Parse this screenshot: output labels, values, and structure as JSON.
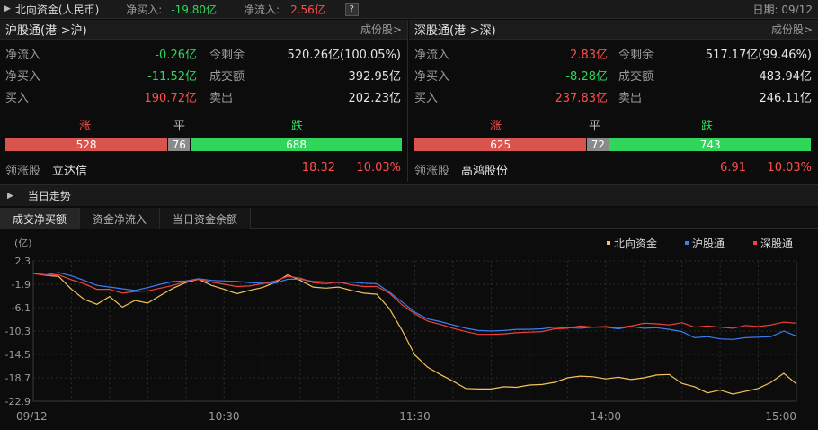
{
  "topbar": {
    "title": "北向资金(人民币)",
    "net_buy_label": "净买入:",
    "net_buy_value": "-19.80亿",
    "net_inflow_label": "净流入:",
    "net_inflow_value": "2.56亿",
    "help": "?",
    "date": "日期: 09/12"
  },
  "sh": {
    "title": "沪股通(港->沪)",
    "link": "成份股>",
    "net_inflow_label": "净流入",
    "net_inflow": "-0.26亿",
    "remain_label": "今剩余",
    "remain": "520.26亿(100.05%)",
    "net_buy_label": "净买入",
    "net_buy": "-11.52亿",
    "turnover_label": "成交额",
    "turnover": "392.95亿",
    "buy_label": "买入",
    "buy": "190.72亿",
    "sell_label": "卖出",
    "sell": "202.23亿",
    "up_label": "涨",
    "flat_label": "平",
    "down_label": "跌",
    "up": 528,
    "flat": 76,
    "down": 688,
    "lead_label": "领涨股",
    "lead_name": "立达信",
    "lead_price": "18.32",
    "lead_pct": "10.03%"
  },
  "sz": {
    "title": "深股通(港->深)",
    "link": "成份股>",
    "net_inflow_label": "净流入",
    "net_inflow": "2.83亿",
    "remain_label": "今剩余",
    "remain": "517.17亿(99.46%)",
    "net_buy_label": "净买入",
    "net_buy": "-8.28亿",
    "turnover_label": "成交额",
    "turnover": "483.94亿",
    "buy_label": "买入",
    "buy": "237.83亿",
    "sell_label": "卖出",
    "sell": "246.11亿",
    "up_label": "涨",
    "flat_label": "平",
    "down_label": "跌",
    "up": 625,
    "flat": 72,
    "down": 743,
    "lead_label": "领涨股",
    "lead_name": "高鸿股份",
    "lead_price": "6.91",
    "lead_pct": "10.03%"
  },
  "trend": {
    "title": "当日走势"
  },
  "tabs": [
    "成交净买额",
    "资金净流入",
    "当日资金余额"
  ],
  "colors": {
    "red": "#ff4d4d",
    "green": "#2fd65a",
    "gray": "#8a8a8a",
    "north": "#f3c35a",
    "sh": "#3b7ff5",
    "sz": "#f0413c"
  },
  "chart_data": {
    "type": "line",
    "unit_label": "(亿)",
    "ylim": [
      -22.9,
      2.3
    ],
    "yticks": [
      "2.3",
      "-1.9",
      "-6.1",
      "-10.3",
      "-14.5",
      "-18.7",
      "-22.9"
    ],
    "xticks": [
      "09/12",
      "10:30",
      "11:30",
      "14:00",
      "15:00"
    ],
    "x": [
      0,
      4,
      8,
      12,
      16,
      20,
      24,
      28,
      32,
      36,
      40,
      44,
      48,
      52,
      56,
      60,
      64,
      68,
      72,
      76,
      80,
      84,
      88,
      92,
      96,
      100,
      104,
      108,
      112,
      116,
      120,
      124,
      128,
      132,
      136,
      140,
      144,
      148,
      152,
      156,
      160,
      164,
      168,
      172,
      176,
      180,
      184,
      188,
      192,
      196,
      200,
      204,
      208,
      212,
      216,
      220,
      224,
      228,
      232,
      236,
      240
    ],
    "series": [
      {
        "name": "北向资金",
        "values": [
          0.1,
          -0.3,
          -0.5,
          -2.8,
          -4.6,
          -5.5,
          -4.1,
          -6.0,
          -4.8,
          -5.3,
          -3.9,
          -2.6,
          -1.6,
          -1.0,
          -2.1,
          -2.8,
          -3.6,
          -3.0,
          -2.5,
          -1.6,
          -0.2,
          -1.2,
          -2.4,
          -2.6,
          -2.4,
          -3.0,
          -3.5,
          -3.7,
          -6.3,
          -10.2,
          -14.6,
          -16.8,
          -18.1,
          -19.3,
          -20.6,
          -20.7,
          -20.7,
          -20.3,
          -20.4,
          -20.0,
          -19.9,
          -19.5,
          -18.7,
          -18.4,
          -18.5,
          -18.9,
          -18.6,
          -19.0,
          -18.7,
          -18.2,
          -18.1,
          -19.7,
          -20.3,
          -21.4,
          -20.9,
          -21.6,
          -21.1,
          -20.6,
          -19.5,
          -17.9,
          -19.8
        ]
      },
      {
        "name": "沪股通",
        "values": [
          0.1,
          -0.2,
          0.2,
          -0.4,
          -1.2,
          -2.1,
          -2.4,
          -2.7,
          -3.0,
          -2.5,
          -1.9,
          -1.4,
          -1.3,
          -0.9,
          -1.2,
          -1.3,
          -1.4,
          -1.6,
          -1.7,
          -1.7,
          -1.0,
          -1.0,
          -1.4,
          -1.5,
          -1.6,
          -1.5,
          -1.7,
          -1.8,
          -3.3,
          -5.1,
          -6.9,
          -8.1,
          -8.6,
          -9.2,
          -9.8,
          -10.2,
          -10.3,
          -10.2,
          -10.0,
          -10.0,
          -9.9,
          -9.6,
          -9.7,
          -9.8,
          -9.6,
          -9.6,
          -9.9,
          -9.5,
          -9.8,
          -9.7,
          -10.0,
          -10.4,
          -11.5,
          -11.3,
          -11.7,
          -11.8,
          -11.5,
          -11.4,
          -11.3,
          -10.3,
          -11.2
        ]
      },
      {
        "name": "深股通",
        "values": [
          0.0,
          -0.3,
          -0.2,
          -1.1,
          -1.8,
          -2.8,
          -2.8,
          -3.5,
          -3.2,
          -3.1,
          -2.6,
          -2.1,
          -1.4,
          -1.0,
          -1.5,
          -1.9,
          -2.3,
          -2.2,
          -1.8,
          -1.3,
          -0.5,
          -0.8,
          -1.6,
          -1.8,
          -1.5,
          -2.0,
          -2.3,
          -2.3,
          -3.5,
          -5.6,
          -7.2,
          -8.5,
          -9.1,
          -9.8,
          -10.4,
          -10.9,
          -10.9,
          -10.8,
          -10.6,
          -10.5,
          -10.4,
          -9.9,
          -9.8,
          -9.4,
          -9.6,
          -9.5,
          -9.7,
          -9.4,
          -8.9,
          -9.0,
          -9.2,
          -8.8,
          -9.6,
          -9.4,
          -9.6,
          -9.8,
          -9.3,
          -9.5,
          -9.2,
          -8.7,
          -8.9
        ]
      }
    ],
    "legend_position": "top-right",
    "grid": true
  }
}
